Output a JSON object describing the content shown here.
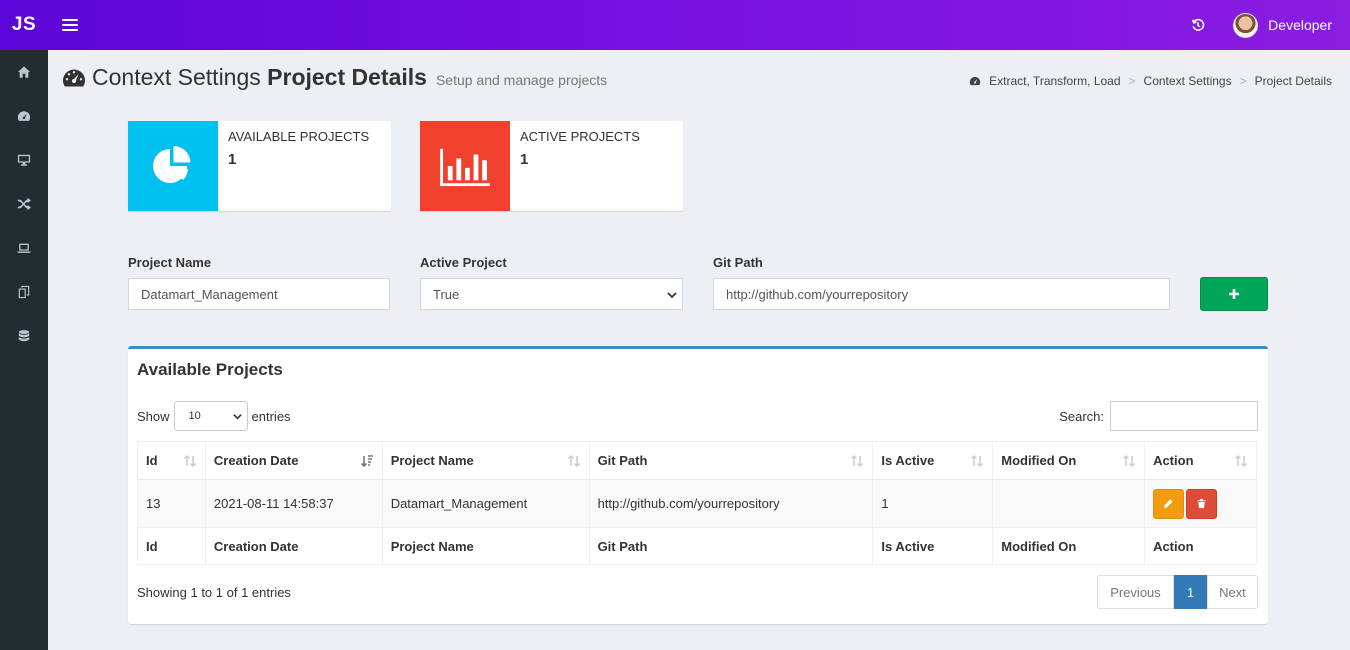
{
  "header": {
    "logo": "JS",
    "user_name": "Developer"
  },
  "sidebar": {
    "items": [
      "home-icon",
      "dashboard-icon",
      "desktop-icon",
      "random-icon",
      "laptop-icon",
      "copy-icon",
      "database-icon"
    ]
  },
  "page": {
    "title_light": "Context Settings",
    "title_bold": "Project Details",
    "subtitle": "Setup and manage projects",
    "breadcrumb": [
      "Extract, Transform, Load",
      "Context Settings",
      "Project Details"
    ],
    "breadcrumb_sep": ">"
  },
  "stats": [
    {
      "label": "AVAILABLE PROJECTS",
      "value": "1",
      "color": "#00c0ef",
      "icon": "pie-chart-icon"
    },
    {
      "label": "ACTIVE PROJECTS",
      "value": "1",
      "color": "#f0412d",
      "icon": "bar-chart-icon"
    }
  ],
  "form": {
    "project_name_label": "Project Name",
    "project_name_value": "Datamart_Management",
    "active_label": "Active Project",
    "active_value": "True",
    "git_label": "Git Path",
    "git_value": "http://github.com/yourrepository",
    "add_icon": "plus-icon"
  },
  "panel": {
    "title": "Available Projects",
    "show_label": "Show",
    "entries_value": "10",
    "entries_label": "entries",
    "search_label": "Search:",
    "columns": [
      "Id",
      "Creation Date",
      "Project Name",
      "Git Path",
      "Is Active",
      "Modified On",
      "Action"
    ],
    "rows": [
      {
        "id": "13",
        "creation_date": "2021-08-11 14:58:37",
        "project_name": "Datamart_Management",
        "git_path": "http://github.com/yourrepository",
        "is_active": "1",
        "modified_on": ""
      }
    ],
    "showing_text": "Showing 1 to 1 of 1 entries",
    "pager": {
      "previous": "Previous",
      "current": "1",
      "next": "Next"
    }
  },
  "colors": {
    "header_start": "#5b06d8",
    "header_end": "#8a1de0",
    "sidebar": "#222d32",
    "add_button": "#00a65a",
    "edit_button": "#f39c12",
    "delete_button": "#dd4b39",
    "panel_border": "#3c8dbc",
    "page_active": "#337ab7"
  }
}
